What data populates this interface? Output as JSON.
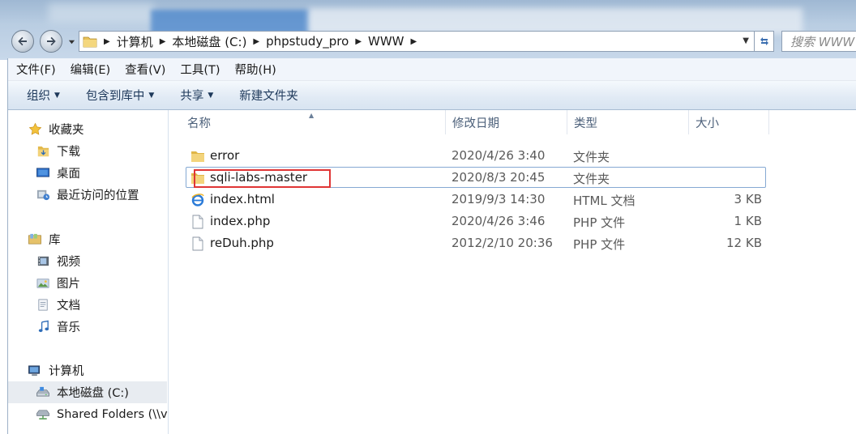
{
  "nav": {
    "back_label": "",
    "forward_label": ""
  },
  "address": {
    "crumbs": [
      "计算机",
      "本地磁盘 (C:)",
      "phpstudy_pro",
      "WWW"
    ]
  },
  "search": {
    "placeholder": "搜索 WWW"
  },
  "menubar": {
    "items": [
      "文件(F)",
      "编辑(E)",
      "查看(V)",
      "工具(T)",
      "帮助(H)"
    ]
  },
  "commandbar": {
    "organize": "组织",
    "include_in_library": "包含到库中",
    "share": "共享",
    "new_folder": "新建文件夹"
  },
  "sidebar": {
    "favorites": {
      "label": "收藏夹",
      "items": [
        "下载",
        "桌面",
        "最近访问的位置"
      ]
    },
    "libraries": {
      "label": "库",
      "items": [
        "视频",
        "图片",
        "文档",
        "音乐"
      ]
    },
    "computer": {
      "label": "计算机",
      "items": [
        "本地磁盘 (C:)",
        "Shared Folders (\\\\v"
      ]
    }
  },
  "columns": {
    "name": "名称",
    "modified": "修改日期",
    "type": "类型",
    "size": "大小"
  },
  "files": [
    {
      "name": "error",
      "modified": "2020/4/26 3:40",
      "type": "文件夹",
      "size": "",
      "icon": "folder-icon"
    },
    {
      "name": "sqli-labs-master",
      "modified": "2020/8/3 20:45",
      "type": "文件夹",
      "size": "",
      "icon": "folder-icon"
    },
    {
      "name": "index.html",
      "modified": "2019/9/3 14:30",
      "type": "HTML 文档",
      "size": "3 KB",
      "icon": "ie-html-icon"
    },
    {
      "name": "index.php",
      "modified": "2020/4/26 3:46",
      "type": "PHP 文件",
      "size": "1 KB",
      "icon": "file-icon"
    },
    {
      "name": "reDuh.php",
      "modified": "2012/2/10 20:36",
      "type": "PHP 文件",
      "size": "12 KB",
      "icon": "file-icon"
    }
  ],
  "colors": {
    "highlight_box": "#e03535",
    "command_text": "#1e395b",
    "column_header_text": "#4c607a"
  }
}
